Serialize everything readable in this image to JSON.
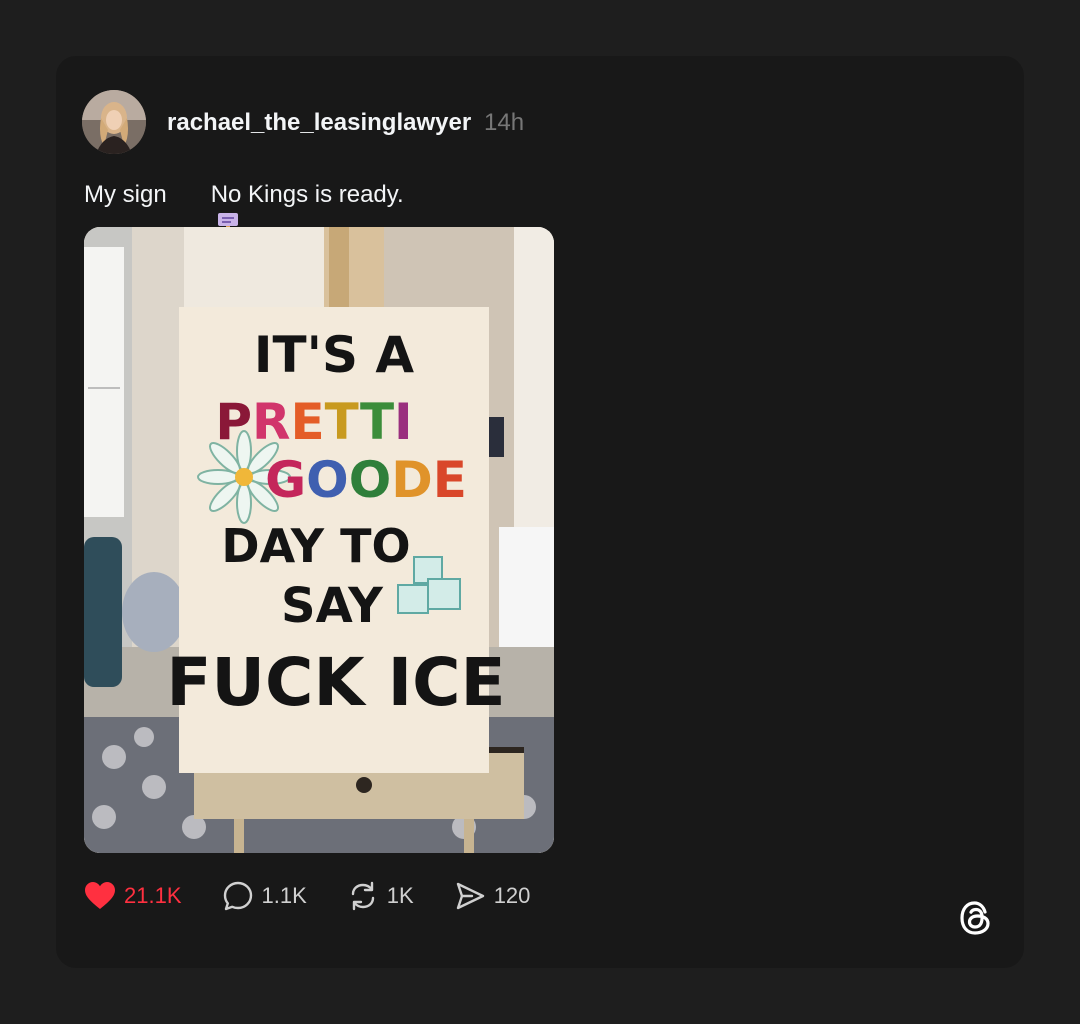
{
  "post": {
    "username": "rachael_the_leasinglawyer",
    "time": "14h",
    "text_before": "My sign",
    "text_emoji_icon": "placard-icon",
    "text_after": "No Kings is ready.",
    "image": {
      "sign_lines": [
        "IT'S A",
        "PRETTI",
        "GOODE",
        "DAY TO",
        "SAY",
        "FUCK ICE"
      ],
      "pretti_letters": [
        "P",
        "R",
        "E",
        "T",
        "T",
        "I"
      ],
      "pretti_colors": [
        "#8a1838",
        "#d1356b",
        "#e45d27",
        "#c89a1f",
        "#3b8d3a",
        "#9a2f7e"
      ],
      "goode_letters": [
        "G",
        "O",
        "O",
        "D",
        "E"
      ],
      "goode_colors": [
        "#c4265b",
        "#3f5fb0",
        "#2f7f3a",
        "#e0932a",
        "#d9472a"
      ]
    }
  },
  "actions": {
    "likes": "21.1K",
    "like_icon": "heart-icon",
    "like_color": "#ff3040",
    "comments": "1.1K",
    "comment_icon": "comment-icon",
    "reposts": "1K",
    "repost_icon": "repost-icon",
    "shares": "120",
    "share_icon": "send-icon"
  },
  "brand": {
    "icon": "threads-logo-icon"
  }
}
